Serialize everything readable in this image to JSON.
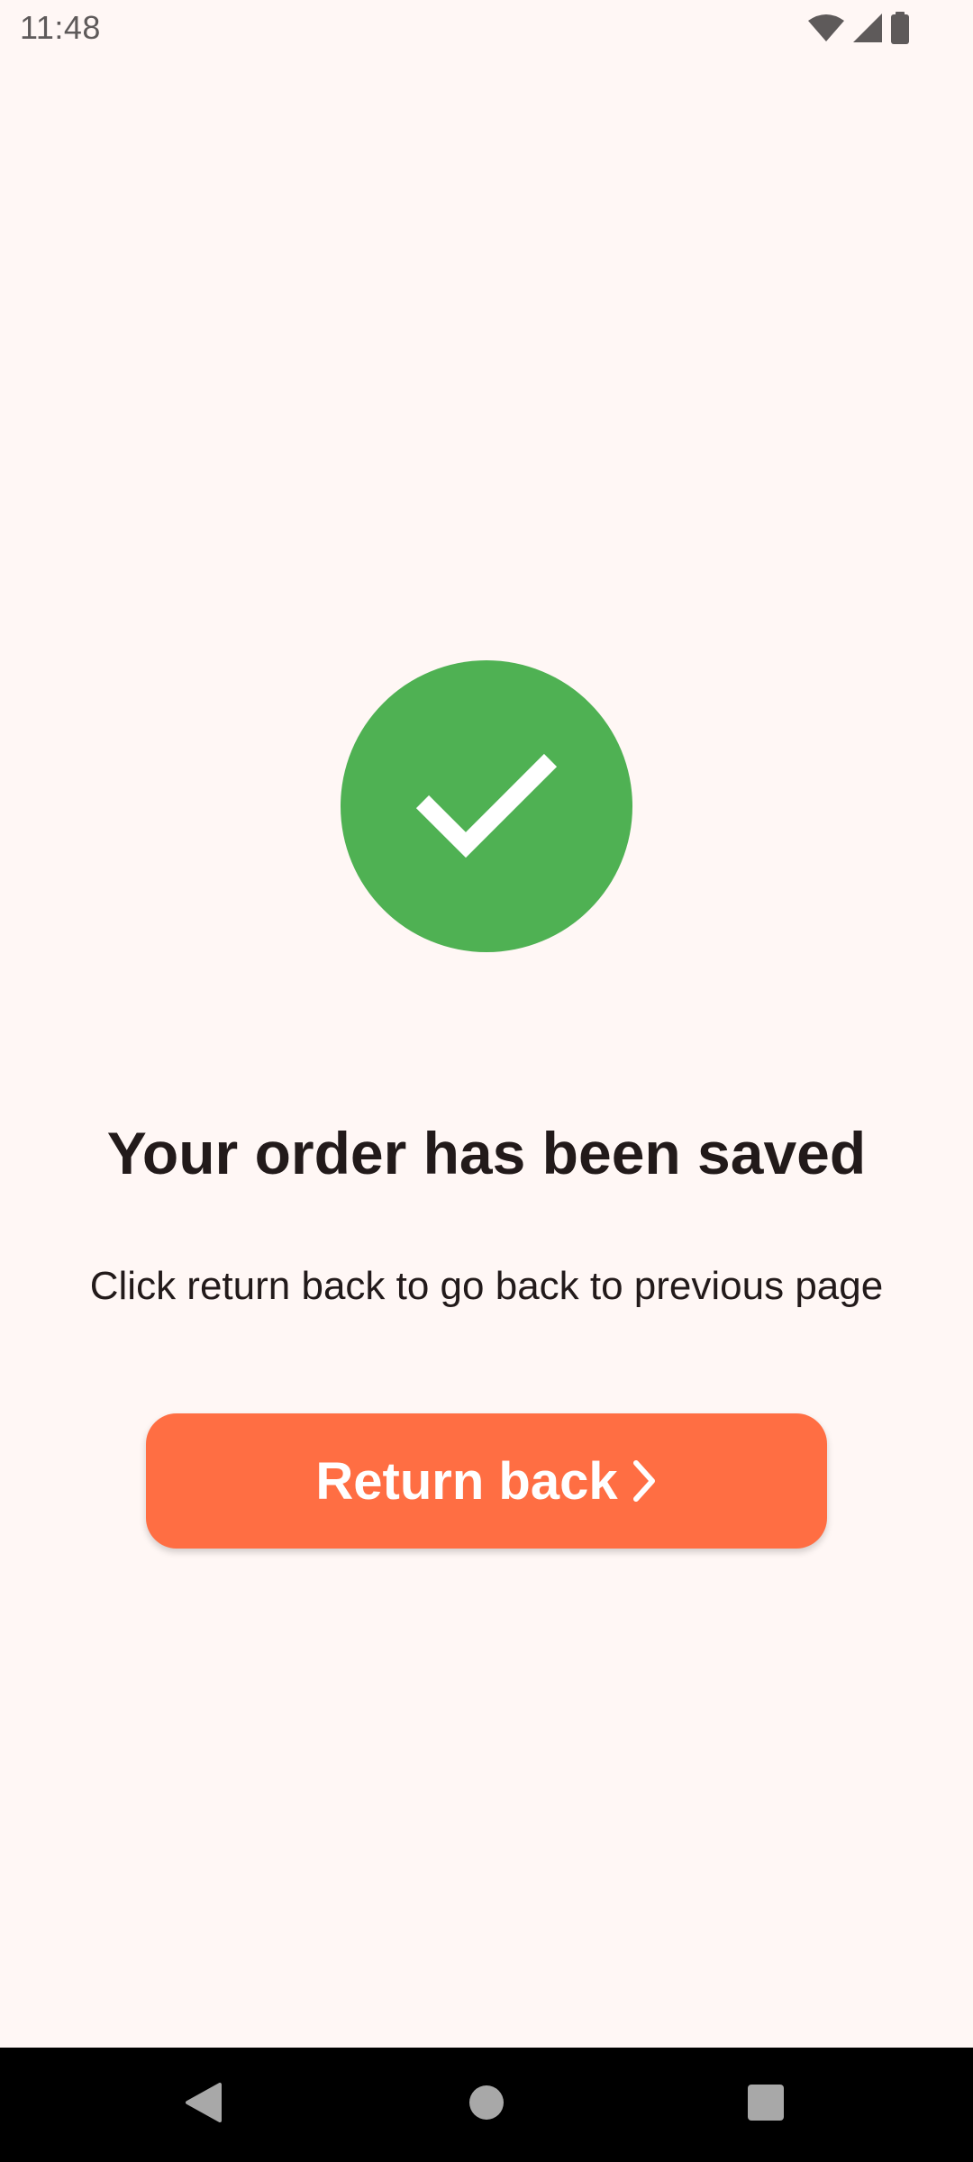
{
  "status_bar": {
    "time": "11:48",
    "icons": [
      "wifi-icon",
      "signal-icon",
      "battery-icon"
    ]
  },
  "success_badge": {
    "icon": "checkmark-icon",
    "color": "#4FB153"
  },
  "main": {
    "title": "Your order has been saved",
    "subtitle": "Click return back to go back to previous page",
    "return_button": {
      "label": "Return back",
      "icon": "chevron-right-icon",
      "color": "#FF6E43"
    }
  },
  "nav_bar": {
    "buttons": [
      "back-icon",
      "home-icon",
      "recents-icon"
    ]
  },
  "colors": {
    "background": "#FFF7F5",
    "text": "#221A1A",
    "accent": "#FF6E43",
    "success": "#4FB153"
  }
}
